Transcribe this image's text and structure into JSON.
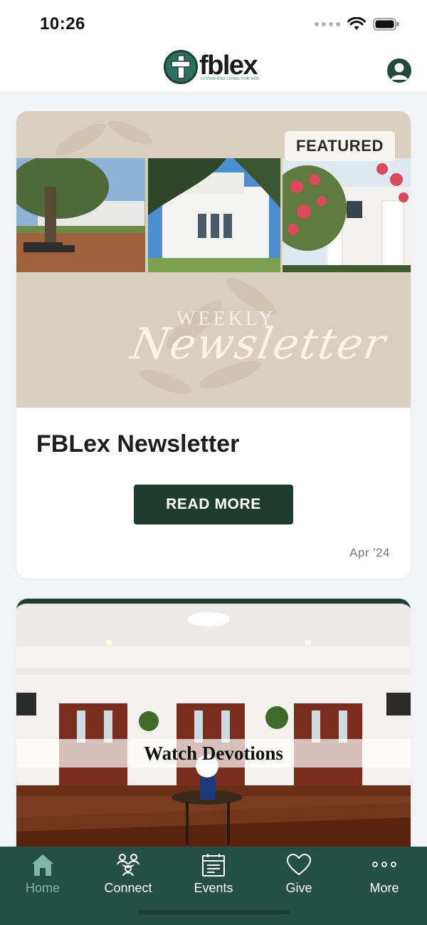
{
  "status_bar": {
    "time": "10:26"
  },
  "header": {
    "logo_word": "fblex",
    "logo_tagline": "LOVING AND LIVING FOR GOD",
    "profile_icon": "user-circle-icon"
  },
  "cards": [
    {
      "badge": "FEATURED",
      "hero_text_line1": "WEEKLY",
      "hero_text_line2": "Newsletter",
      "title": "FBLex Newsletter",
      "button_label": "READ MORE",
      "date": "Apr '24"
    },
    {
      "label": "Watch Devotions"
    }
  ],
  "tab_bar": {
    "tabs": [
      {
        "label": "Home",
        "icon": "home-icon",
        "active": true
      },
      {
        "label": "Connect",
        "icon": "people-icon",
        "active": false
      },
      {
        "label": "Events",
        "icon": "calendar-icon",
        "active": false
      },
      {
        "label": "Give",
        "icon": "heart-icon",
        "active": false
      },
      {
        "label": "More",
        "icon": "more-dots-icon",
        "active": false
      }
    ]
  },
  "colors": {
    "brand_dark_green": "#1e3d2f",
    "tab_bar_green": "#254f45",
    "active_tab": "#7fb7a7",
    "hero_beige": "#d9cfbe"
  }
}
